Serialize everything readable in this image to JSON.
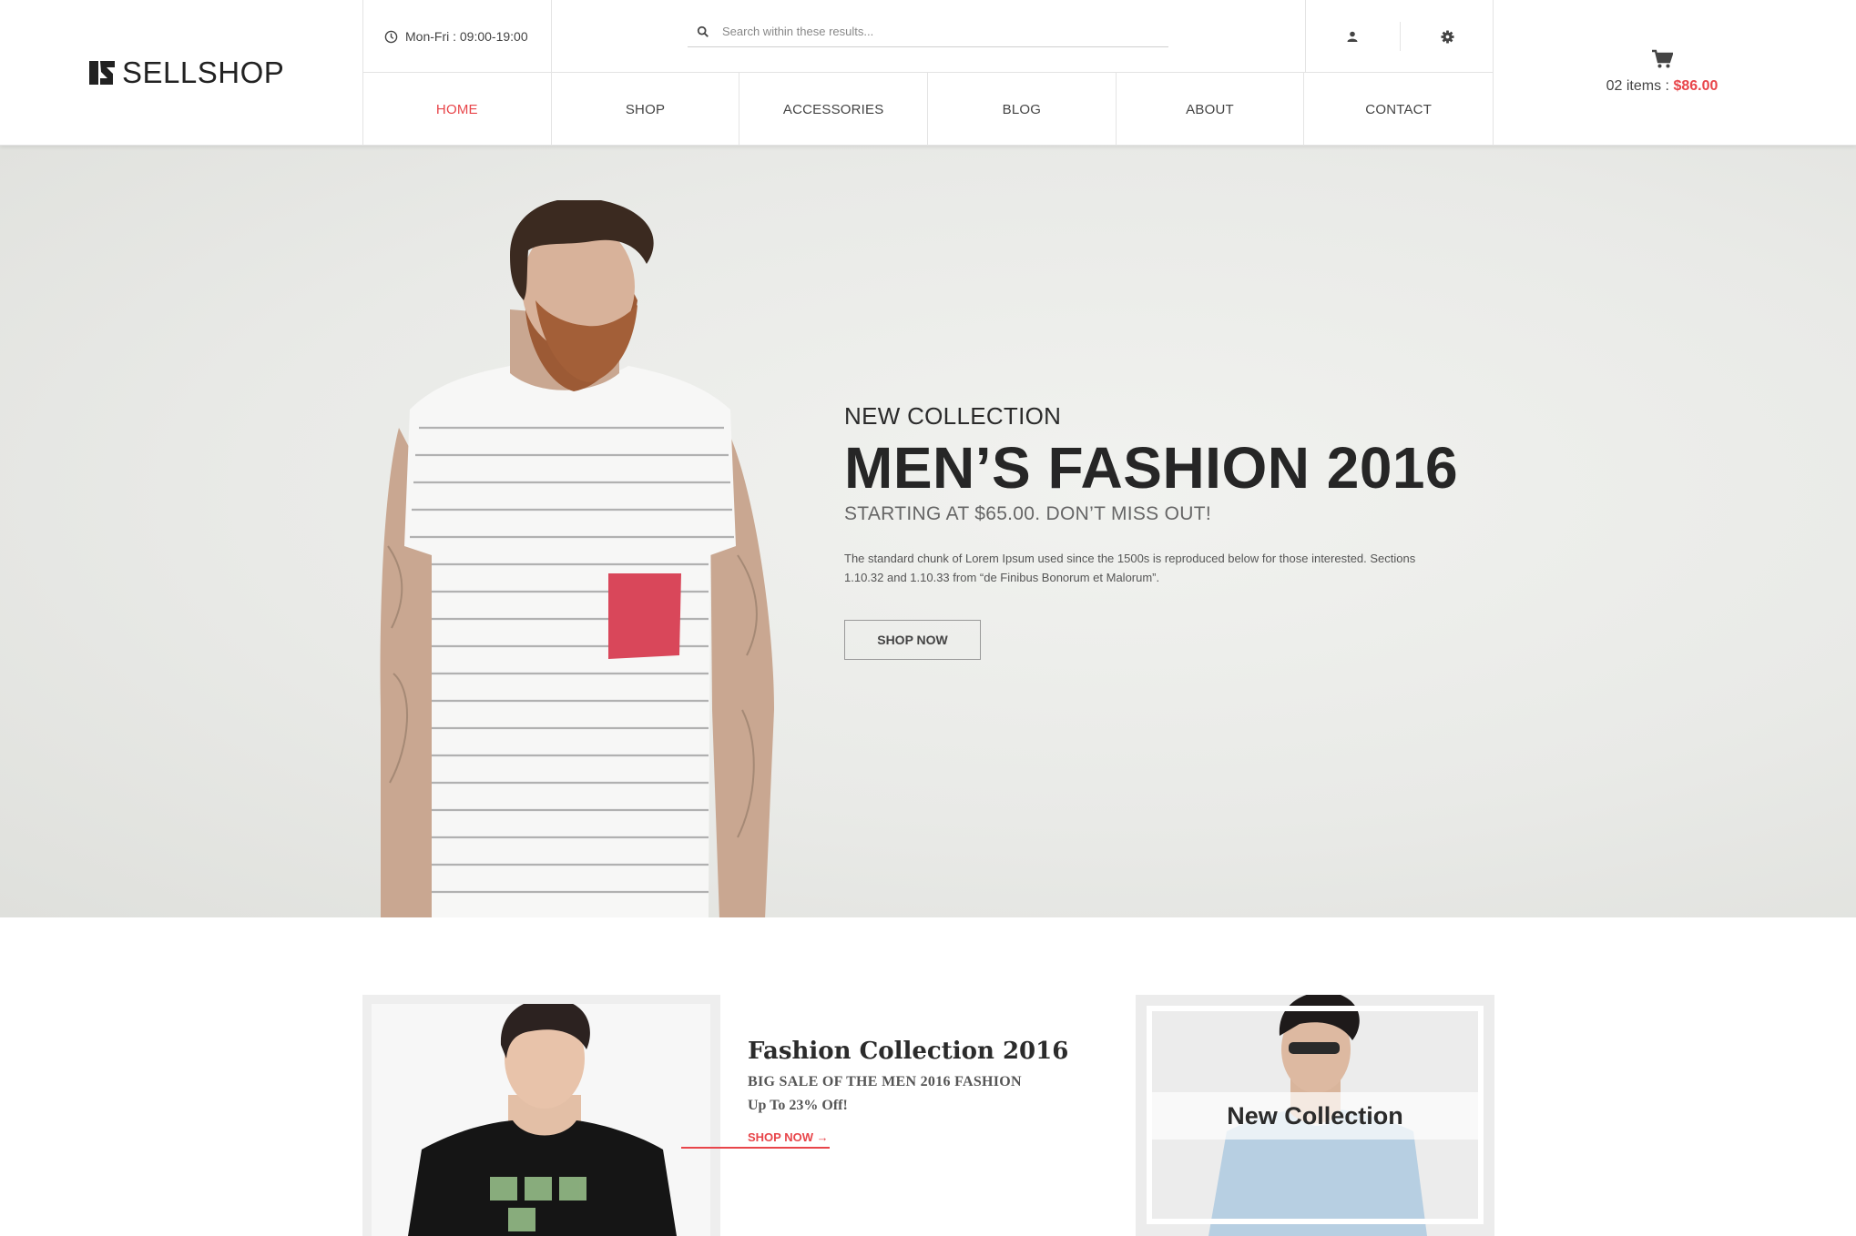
{
  "brand": {
    "name": "SELLSHOP"
  },
  "header": {
    "hours": "Mon-Fri : 09:00-19:00",
    "search_placeholder": "Search within these results...",
    "nav": [
      "HOME",
      "SHOP",
      "ACCESSORIES",
      "BLOG",
      "ABOUT",
      "CONTACT"
    ],
    "active_nav": "HOME",
    "cart": {
      "items_label": "02 items :",
      "total": "$86.00"
    }
  },
  "hero": {
    "kicker": "NEW COLLECTION",
    "title": "MEN’S FASHION 2016",
    "subtitle": "STARTING AT $65.00. DON’T MISS OUT!",
    "description": "The standard chunk of Lorem Ipsum used since the 1500s is reproduced below for those interested. Sections 1.10.32 and 1.10.33 from “de Finibus Bonorum et Malorum”.",
    "button": "SHOP NOW"
  },
  "promo": {
    "left": {
      "title": "Fashion Collection 2016",
      "subtitle": "BIG SALE OF THE MEN 2016 FASHION",
      "offer": "Up To 23% Off!",
      "link": "SHOP NOW →"
    },
    "right": {
      "label": "New Collection"
    }
  },
  "colors": {
    "accent": "#e8454a",
    "text": "#333333",
    "border": "#e4e4e4"
  },
  "icons": [
    "clock-icon",
    "search-icon",
    "user-icon",
    "gear-icon",
    "cart-icon"
  ]
}
